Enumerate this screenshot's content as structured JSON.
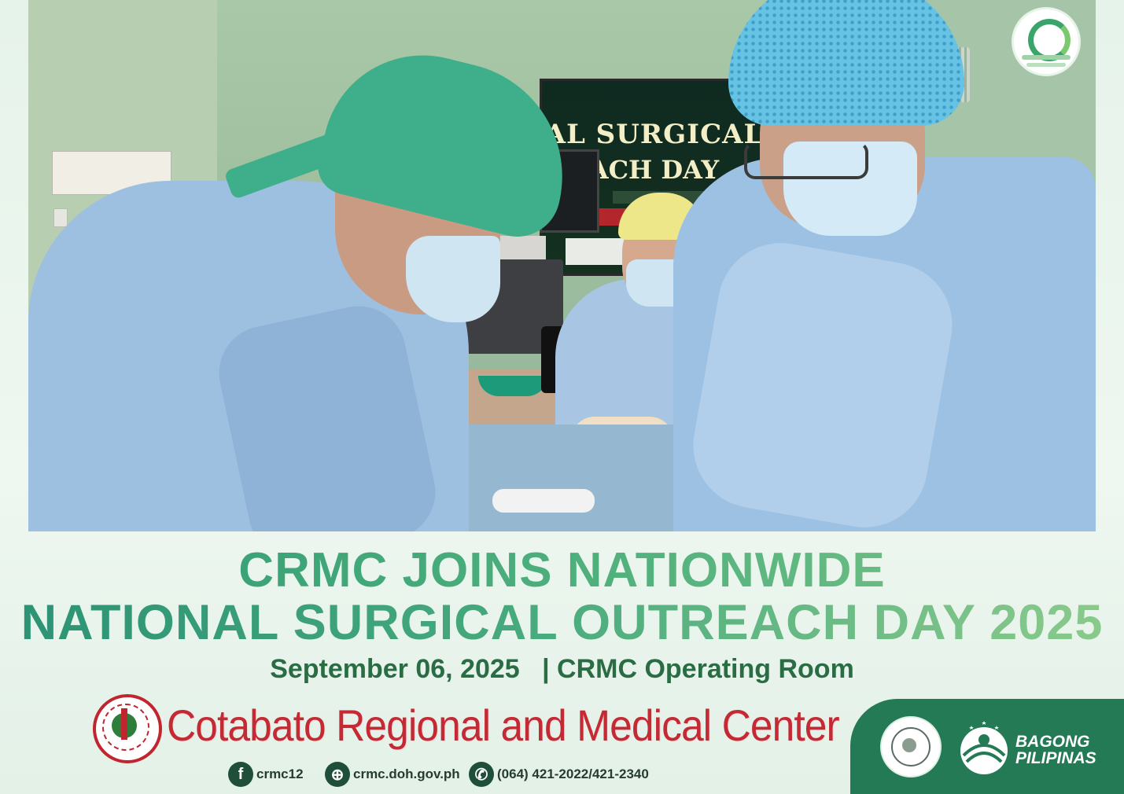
{
  "headline": {
    "line1": "CRMC JOINS NATIONWIDE",
    "line2": "NATIONAL SURGICAL OUTREACH DAY 2025"
  },
  "subline": {
    "date": "September 06, 2025",
    "separator": "|",
    "venue": "CRMC Operating Room"
  },
  "photo_banner": {
    "line1": "AL SURGICAL",
    "line2": "ACH DAY"
  },
  "organization": {
    "name": "Cotabato Regional and Medical Center",
    "seal_icon": "department-of-health-crmc-seal-icon"
  },
  "contacts": [
    {
      "icon": "facebook-icon",
      "glyph": "f",
      "text": "crmc12"
    },
    {
      "icon": "globe-icon",
      "glyph": "⊕",
      "text": "crmc.doh.gov.ph"
    },
    {
      "icon": "phone-icon",
      "glyph": "✆",
      "text": "(064) 421-2022/421-2340"
    }
  ],
  "gov_block": {
    "brand_line1": "BAGONG",
    "brand_line2": "PILIPINAS",
    "doh_seal_icon": "republic-of-the-philippines-doh-seal-icon",
    "bp_logo_icon": "bagong-pilipinas-logo-icon"
  },
  "colors": {
    "headline_start": "#2e9a74",
    "headline_end": "#8ccb8c",
    "subline": "#2a6d45",
    "org_name": "#c42a33",
    "gov_block_bg": "#237a55"
  }
}
